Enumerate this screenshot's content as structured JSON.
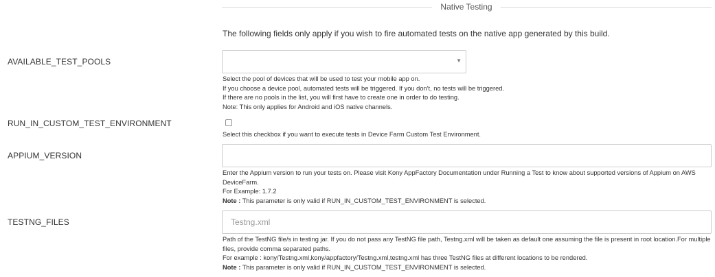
{
  "section": {
    "title": "Native Testing"
  },
  "intro": "The following fields only apply if you wish to fire automated tests on the native app generated by this build.",
  "fields": {
    "test_pools": {
      "label": "AVAILABLE_TEST_POOLS",
      "value": "",
      "icon": "chevron-down-icon",
      "help": [
        "Select the pool of devices that will be used to test your mobile app on.",
        "If you choose a device pool, automated tests will be triggered. If you don't, no tests will be triggered.",
        "If there are no pools in the list, you will first have to create one in order to do testing.",
        "Note: This only applies for Android and iOS native channels."
      ]
    },
    "custom_env": {
      "label": "RUN_IN_CUSTOM_TEST_ENVIRONMENT",
      "checked": false,
      "help": "Select this checkbox if you want to execute tests in Device Farm Custom Test Environment."
    },
    "appium_version": {
      "label": "APPIUM_VERSION",
      "value": "",
      "placeholder": "",
      "help": "Enter the Appium version to run your tests on. Please visit Kony AppFactory Documentation under Running a Test to know about supported versions of Appium on AWS DeviceFarm.",
      "example": "For Example: 1.7.2",
      "note_label": "Note :",
      "note": " This parameter is only valid if RUN_IN_CUSTOM_TEST_ENVIRONMENT is selected."
    },
    "testng_files": {
      "label": "TESTNG_FILES",
      "value": "",
      "placeholder": "Testng.xml",
      "help": "Path of the TestNG file/s in testing jar. If you do not pass any TestNG file path, Testng.xml will be taken as default one assuming the file is present in root location.For multiple files, provide comma separated paths.",
      "example": "For example : kony/Testng.xml,kony/appfactory/Testng.xml,testng.xml has three TestNG files at different locations to be rendered.",
      "note_label": "Note :",
      "note": " This parameter is only valid if RUN_IN_CUSTOM_TEST_ENVIRONMENT is selected."
    }
  }
}
